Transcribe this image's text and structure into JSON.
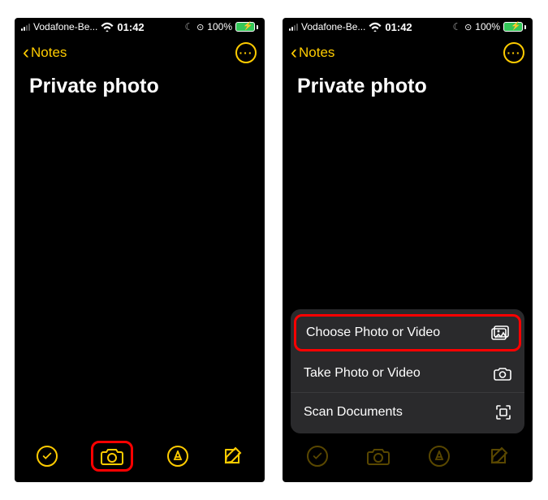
{
  "status": {
    "carrier": "Vodafone-Be...",
    "time": "01:42",
    "battery_pct": "100%"
  },
  "nav": {
    "back_label": "Notes",
    "more": "···"
  },
  "note": {
    "title": "Private photo"
  },
  "menu": {
    "choose": "Choose Photo or Video",
    "take": "Take Photo or Video",
    "scan": "Scan Documents"
  }
}
